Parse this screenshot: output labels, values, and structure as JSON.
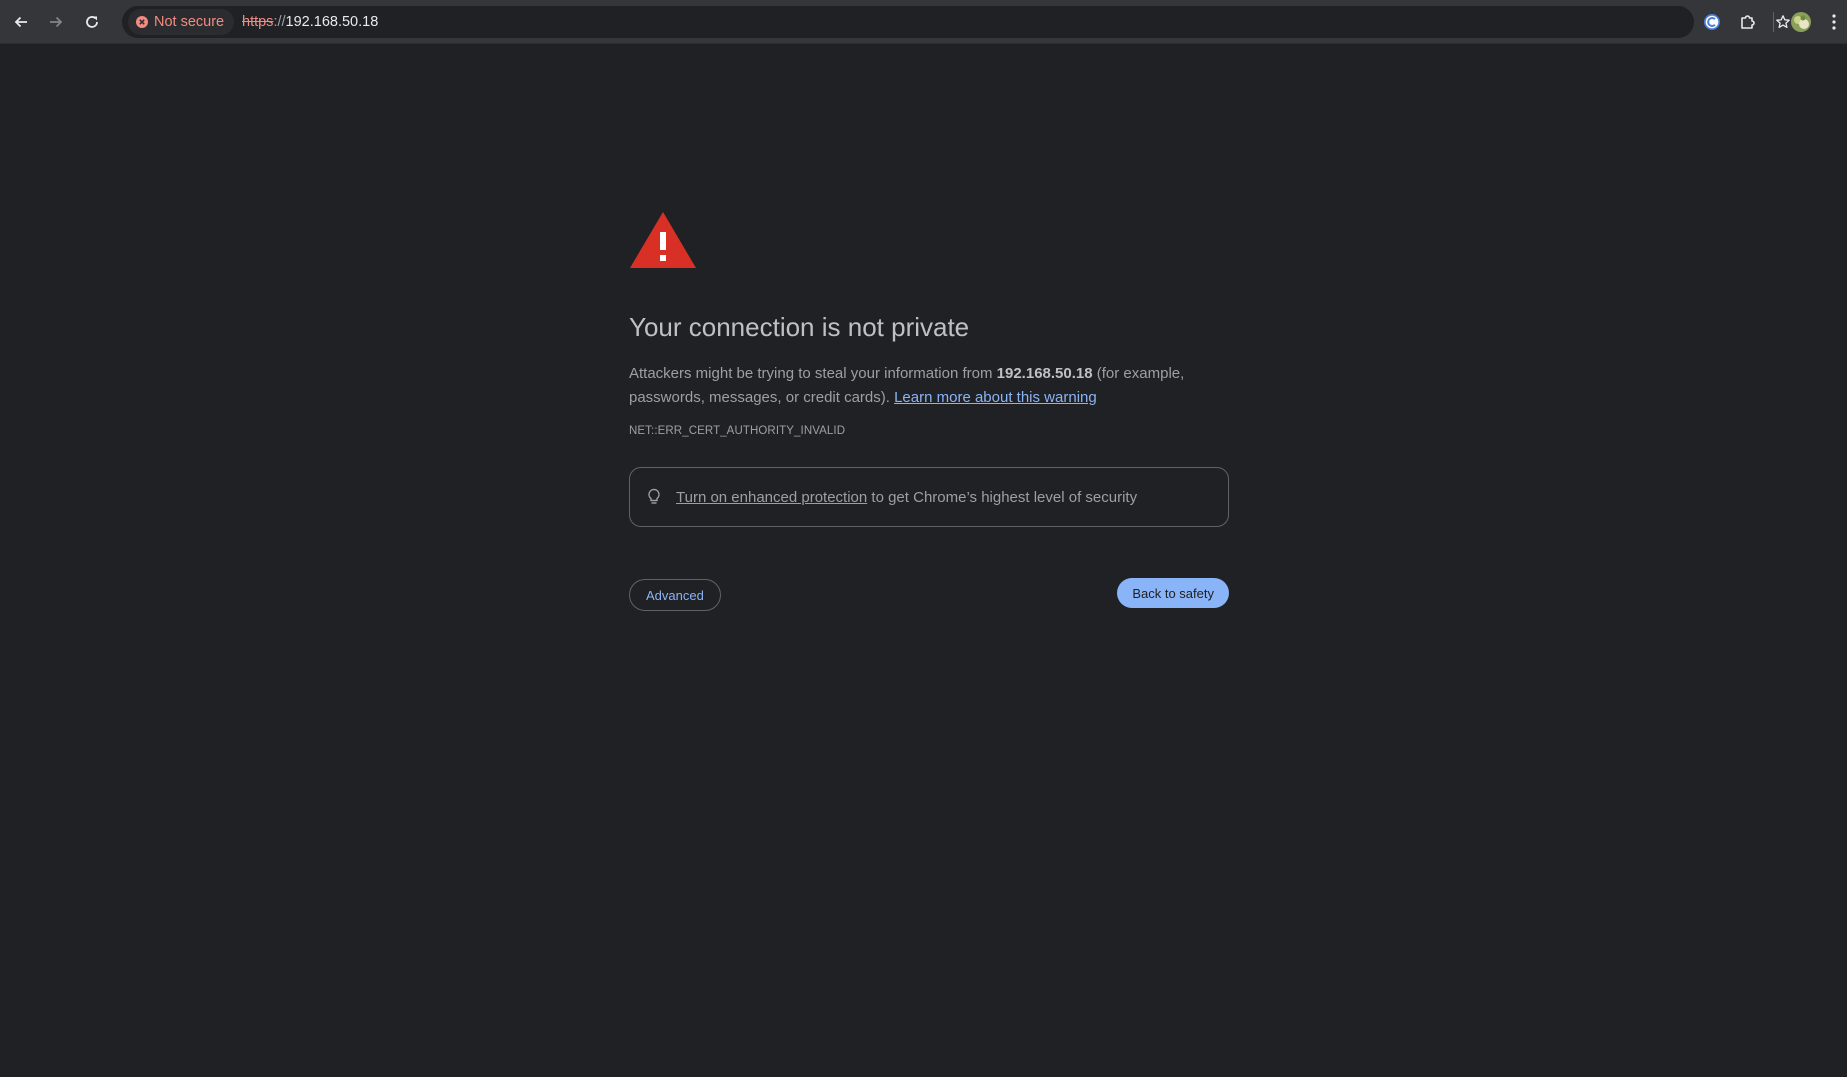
{
  "toolbar": {
    "back_icon": "arrow-left-icon",
    "forward_icon": "arrow-right-icon",
    "reload_icon": "reload-icon",
    "security_chip": {
      "icon": "error-circle-icon",
      "label": "Not secure",
      "color": "#f28b82"
    },
    "url": {
      "scheme": "https",
      "separator": "://",
      "host": "192.168.50.18"
    },
    "bookmark_icon": "star-icon",
    "extension_icon": "chrome-extension-c-icon",
    "extensions_menu_icon": "puzzle-piece-icon",
    "profile_icon": "avatar-icon",
    "menu_icon": "kebab-menu-icon"
  },
  "interstitial": {
    "warning_icon": "warning-triangle-icon",
    "warning_color": "#d93025",
    "heading": "Your connection is not private",
    "body_prefix": "Attackers might be trying to steal your information from ",
    "body_host": "192.168.50.18",
    "body_suffix": " (for example, passwords, messages, or credit cards). ",
    "learn_more_link": "Learn more about this warning",
    "error_code": "NET::ERR_CERT_AUTHORITY_INVALID",
    "protection": {
      "icon": "lightbulb-icon",
      "link_text": "Turn on enhanced protection",
      "rest_text": " to get Chrome’s highest level of security"
    },
    "advanced_button": "Advanced",
    "back_to_safety_button": "Back to safety",
    "accent_color": "#8ab4f8"
  }
}
